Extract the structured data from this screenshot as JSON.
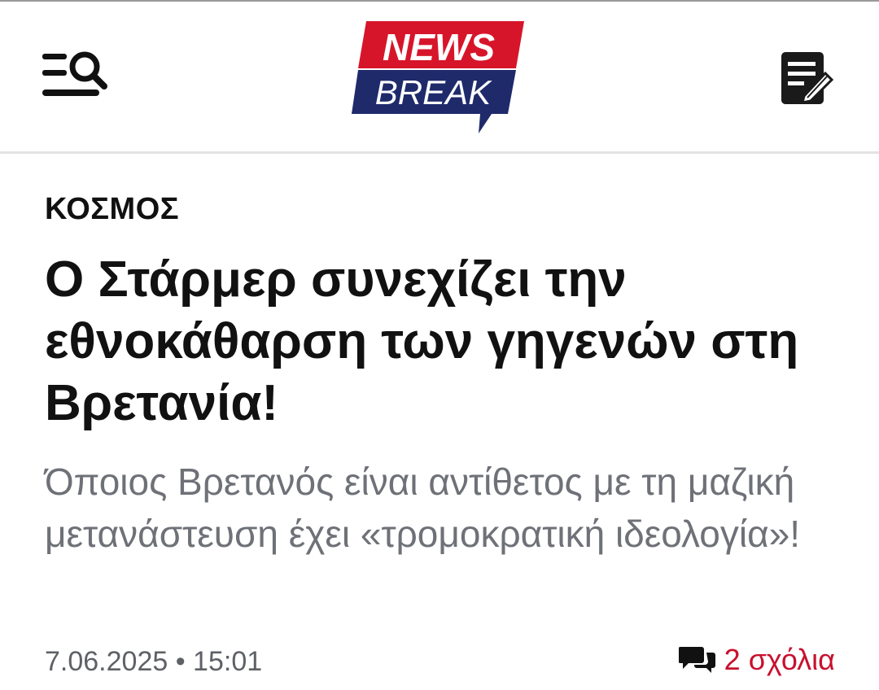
{
  "header": {
    "logo": {
      "line1": "NEWS",
      "line2": "BREAK",
      "brand_red": "#d7152a",
      "brand_navy": "#1f2a6b"
    },
    "menu_icon": "menu-search-icon",
    "edit_icon": "edit-note-icon"
  },
  "article": {
    "category": "ΚΟΣΜΟΣ",
    "headline": "Ο Στάρμερ συνεχίζει την εθνοκάθαρση των γηγενών στη Βρετανία!",
    "subtitle": "Όποιος Βρετανός είναι αντίθετος με τη μαζική μετανάστευση έχει «τρομοκρατική ιδεολογία»!",
    "date": "7.06.2025 • 15:01",
    "comments_label": "2 σχόλια",
    "comments_icon": "chat-bubbles-icon",
    "accent_color": "#c8102e"
  }
}
